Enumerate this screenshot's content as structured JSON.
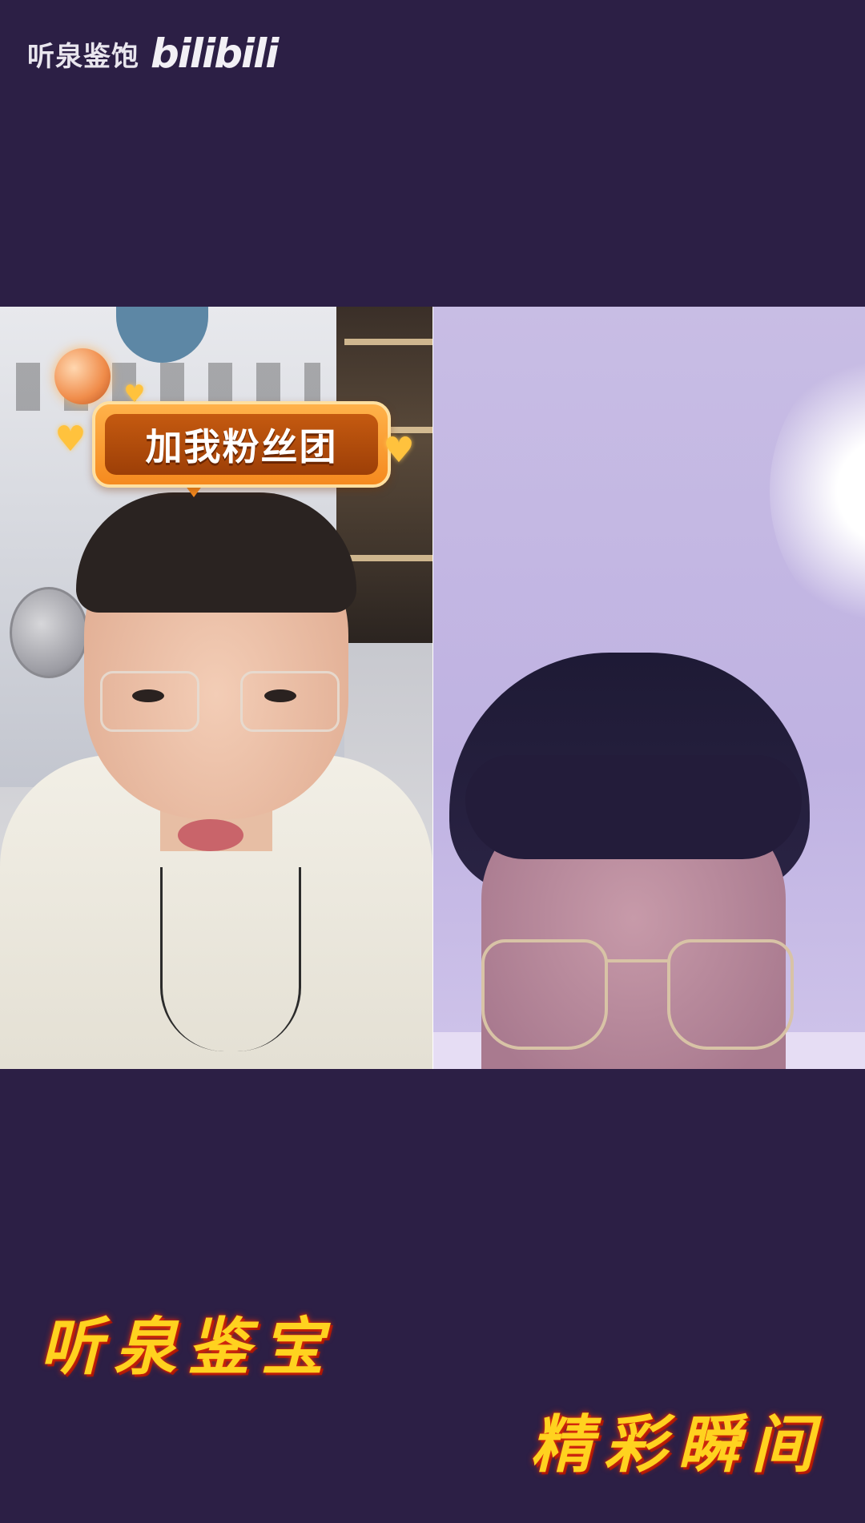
{
  "watermark": {
    "channel_name": "听泉鉴饱",
    "platform_logo": "bilibili"
  },
  "left_panel": {
    "sticker_text": "加我粉丝团"
  },
  "captions": {
    "left": "听泉鉴宝",
    "right": "精彩瞬间"
  },
  "colors": {
    "background": "#2c1f45",
    "caption_text": "#ffd21f",
    "caption_glow": "#e0320f",
    "sticker_orange": "#f58a1f"
  },
  "icons": [
    "heart-icon",
    "disco-ball-icon"
  ]
}
